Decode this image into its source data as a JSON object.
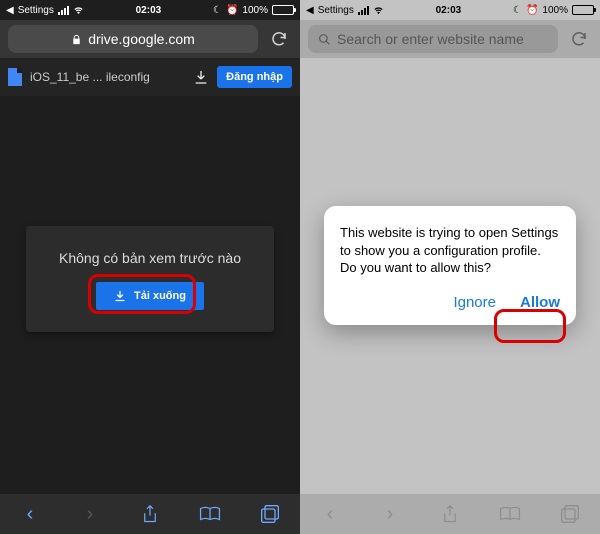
{
  "left": {
    "status": {
      "carrier": "Settings",
      "time": "02:03",
      "battery_pct": "100%"
    },
    "url": "drive.google.com",
    "file_name": "iOS_11_be ... ileconfig",
    "signin_label": "Đăng nhập",
    "card_title": "Không có bản xem trước nào",
    "download_label": "Tải xuống"
  },
  "right": {
    "status": {
      "carrier": "Settings",
      "time": "02:03",
      "battery_pct": "100%"
    },
    "url_placeholder": "Search or enter website name",
    "alert_text": "This website is trying to open Settings to show you a configuration profile. Do you want to allow this?",
    "ignore_label": "Ignore",
    "allow_label": "Allow"
  }
}
